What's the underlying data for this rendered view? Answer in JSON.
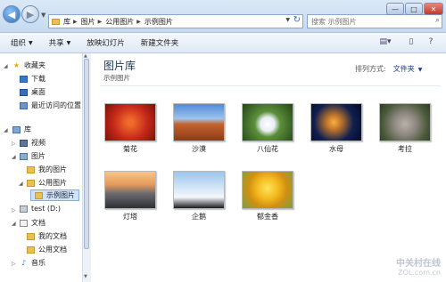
{
  "address": {
    "crumbs": [
      "库",
      "图片",
      "公用图片",
      "示例图片"
    ]
  },
  "search": {
    "placeholder": "搜索 示例图片"
  },
  "toolbar": {
    "organize": "组织",
    "share": "共享",
    "slideshow": "放映幻灯片",
    "new_folder": "新建文件夹"
  },
  "nav": {
    "favorites": "收藏夹",
    "downloads": "下载",
    "desktop": "桌面",
    "recent": "最近访问的位置",
    "libraries": "库",
    "videos": "视频",
    "pictures": "图片",
    "my_pictures": "我的图片",
    "public_pictures": "公用图片",
    "sample_pictures": "示例图片",
    "test_drive": "test (D:)",
    "documents": "文档",
    "my_documents": "我的文档",
    "public_documents": "公用文档",
    "music": "音乐"
  },
  "library": {
    "title": "图片库",
    "subtitle": "示例图片"
  },
  "arrange": {
    "label": "排列方式:",
    "value": "文件夹"
  },
  "files": [
    "菊花",
    "沙漠",
    "八仙花",
    "水母",
    "考拉",
    "灯塔",
    "企鹅",
    "郁金香"
  ],
  "watermark": {
    "line1": "中关村在线",
    "line2": "ZOL.com.cn"
  }
}
